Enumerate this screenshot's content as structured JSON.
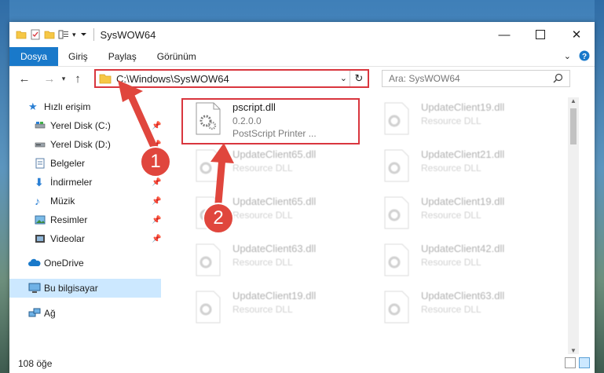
{
  "window": {
    "title": "SysWOW64"
  },
  "ribbon": {
    "tabs": [
      "Dosya",
      "Giriş",
      "Paylaş",
      "Görünüm"
    ]
  },
  "address": {
    "path": "C:\\Windows\\SysWOW64",
    "search_placeholder": "Ara: SysWOW64"
  },
  "sidebar": {
    "items": [
      {
        "label": "Hızlı erişim",
        "icon": "star-icon"
      },
      {
        "label": "Yerel Disk (C:)",
        "icon": "drive-icon"
      },
      {
        "label": "Yerel Disk (D:)",
        "icon": "drive-icon"
      },
      {
        "label": "Belgeler",
        "icon": "documents-icon"
      },
      {
        "label": "İndirmeler",
        "icon": "download-icon"
      },
      {
        "label": "Müzik",
        "icon": "music-icon"
      },
      {
        "label": "Resimler",
        "icon": "pictures-icon"
      },
      {
        "label": "Videolar",
        "icon": "videos-icon"
      },
      {
        "label": "OneDrive",
        "icon": "cloud-icon"
      },
      {
        "label": "Bu bilgisayar",
        "icon": "computer-icon"
      },
      {
        "label": "Ağ",
        "icon": "network-icon"
      }
    ]
  },
  "files": [
    {
      "name": "pscript.dll",
      "line2": "0.2.0.0",
      "line3": "PostScript Printer ..."
    },
    {
      "name": "UpdateClient19.dll",
      "line2": "Resource DLL"
    },
    {
      "name": "UpdateClient65.dll",
      "line2": "Resource DLL"
    },
    {
      "name": "UpdateClient21.dll",
      "line2": "Resource DLL"
    },
    {
      "name": "UpdateClient65.dll",
      "line2": "Resource DLL"
    },
    {
      "name": "UpdateClient19.dll",
      "line2": "Resource DLL"
    },
    {
      "name": "UpdateClient63.dll",
      "line2": "Resource DLL"
    },
    {
      "name": "UpdateClient42.dll",
      "line2": "Resource DLL"
    },
    {
      "name": "UpdateClient19.dll",
      "line2": "Resource DLL"
    },
    {
      "name": "UpdateClient63.dll",
      "line2": "Resource DLL"
    }
  ],
  "status": {
    "item_count": "108 öğe"
  },
  "callouts": [
    "1",
    "2"
  ],
  "colors": {
    "accent": "#1979ca",
    "highlight": "#d9363e",
    "selected": "#cce8ff"
  }
}
